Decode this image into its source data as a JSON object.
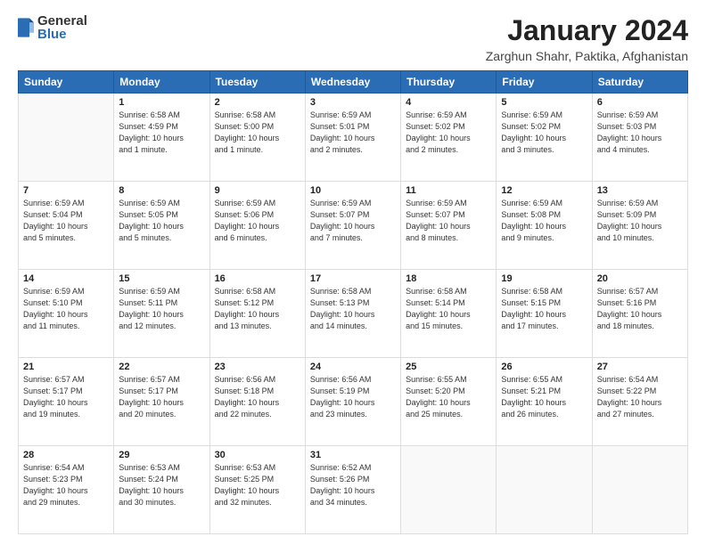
{
  "logo": {
    "general": "General",
    "blue": "Blue"
  },
  "header": {
    "title": "January 2024",
    "subtitle": "Zarghun Shahr, Paktika, Afghanistan"
  },
  "weekdays": [
    "Sunday",
    "Monday",
    "Tuesday",
    "Wednesday",
    "Thursday",
    "Friday",
    "Saturday"
  ],
  "weeks": [
    [
      {
        "day": "",
        "info": ""
      },
      {
        "day": "1",
        "info": "Sunrise: 6:58 AM\nSunset: 4:59 PM\nDaylight: 10 hours\nand 1 minute."
      },
      {
        "day": "2",
        "info": "Sunrise: 6:58 AM\nSunset: 5:00 PM\nDaylight: 10 hours\nand 1 minute."
      },
      {
        "day": "3",
        "info": "Sunrise: 6:59 AM\nSunset: 5:01 PM\nDaylight: 10 hours\nand 2 minutes."
      },
      {
        "day": "4",
        "info": "Sunrise: 6:59 AM\nSunset: 5:02 PM\nDaylight: 10 hours\nand 2 minutes."
      },
      {
        "day": "5",
        "info": "Sunrise: 6:59 AM\nSunset: 5:02 PM\nDaylight: 10 hours\nand 3 minutes."
      },
      {
        "day": "6",
        "info": "Sunrise: 6:59 AM\nSunset: 5:03 PM\nDaylight: 10 hours\nand 4 minutes."
      }
    ],
    [
      {
        "day": "7",
        "info": "Sunrise: 6:59 AM\nSunset: 5:04 PM\nDaylight: 10 hours\nand 5 minutes."
      },
      {
        "day": "8",
        "info": "Sunrise: 6:59 AM\nSunset: 5:05 PM\nDaylight: 10 hours\nand 5 minutes."
      },
      {
        "day": "9",
        "info": "Sunrise: 6:59 AM\nSunset: 5:06 PM\nDaylight: 10 hours\nand 6 minutes."
      },
      {
        "day": "10",
        "info": "Sunrise: 6:59 AM\nSunset: 5:07 PM\nDaylight: 10 hours\nand 7 minutes."
      },
      {
        "day": "11",
        "info": "Sunrise: 6:59 AM\nSunset: 5:07 PM\nDaylight: 10 hours\nand 8 minutes."
      },
      {
        "day": "12",
        "info": "Sunrise: 6:59 AM\nSunset: 5:08 PM\nDaylight: 10 hours\nand 9 minutes."
      },
      {
        "day": "13",
        "info": "Sunrise: 6:59 AM\nSunset: 5:09 PM\nDaylight: 10 hours\nand 10 minutes."
      }
    ],
    [
      {
        "day": "14",
        "info": "Sunrise: 6:59 AM\nSunset: 5:10 PM\nDaylight: 10 hours\nand 11 minutes."
      },
      {
        "day": "15",
        "info": "Sunrise: 6:59 AM\nSunset: 5:11 PM\nDaylight: 10 hours\nand 12 minutes."
      },
      {
        "day": "16",
        "info": "Sunrise: 6:58 AM\nSunset: 5:12 PM\nDaylight: 10 hours\nand 13 minutes."
      },
      {
        "day": "17",
        "info": "Sunrise: 6:58 AM\nSunset: 5:13 PM\nDaylight: 10 hours\nand 14 minutes."
      },
      {
        "day": "18",
        "info": "Sunrise: 6:58 AM\nSunset: 5:14 PM\nDaylight: 10 hours\nand 15 minutes."
      },
      {
        "day": "19",
        "info": "Sunrise: 6:58 AM\nSunset: 5:15 PM\nDaylight: 10 hours\nand 17 minutes."
      },
      {
        "day": "20",
        "info": "Sunrise: 6:57 AM\nSunset: 5:16 PM\nDaylight: 10 hours\nand 18 minutes."
      }
    ],
    [
      {
        "day": "21",
        "info": "Sunrise: 6:57 AM\nSunset: 5:17 PM\nDaylight: 10 hours\nand 19 minutes."
      },
      {
        "day": "22",
        "info": "Sunrise: 6:57 AM\nSunset: 5:17 PM\nDaylight: 10 hours\nand 20 minutes."
      },
      {
        "day": "23",
        "info": "Sunrise: 6:56 AM\nSunset: 5:18 PM\nDaylight: 10 hours\nand 22 minutes."
      },
      {
        "day": "24",
        "info": "Sunrise: 6:56 AM\nSunset: 5:19 PM\nDaylight: 10 hours\nand 23 minutes."
      },
      {
        "day": "25",
        "info": "Sunrise: 6:55 AM\nSunset: 5:20 PM\nDaylight: 10 hours\nand 25 minutes."
      },
      {
        "day": "26",
        "info": "Sunrise: 6:55 AM\nSunset: 5:21 PM\nDaylight: 10 hours\nand 26 minutes."
      },
      {
        "day": "27",
        "info": "Sunrise: 6:54 AM\nSunset: 5:22 PM\nDaylight: 10 hours\nand 27 minutes."
      }
    ],
    [
      {
        "day": "28",
        "info": "Sunrise: 6:54 AM\nSunset: 5:23 PM\nDaylight: 10 hours\nand 29 minutes."
      },
      {
        "day": "29",
        "info": "Sunrise: 6:53 AM\nSunset: 5:24 PM\nDaylight: 10 hours\nand 30 minutes."
      },
      {
        "day": "30",
        "info": "Sunrise: 6:53 AM\nSunset: 5:25 PM\nDaylight: 10 hours\nand 32 minutes."
      },
      {
        "day": "31",
        "info": "Sunrise: 6:52 AM\nSunset: 5:26 PM\nDaylight: 10 hours\nand 34 minutes."
      },
      {
        "day": "",
        "info": ""
      },
      {
        "day": "",
        "info": ""
      },
      {
        "day": "",
        "info": ""
      }
    ]
  ]
}
